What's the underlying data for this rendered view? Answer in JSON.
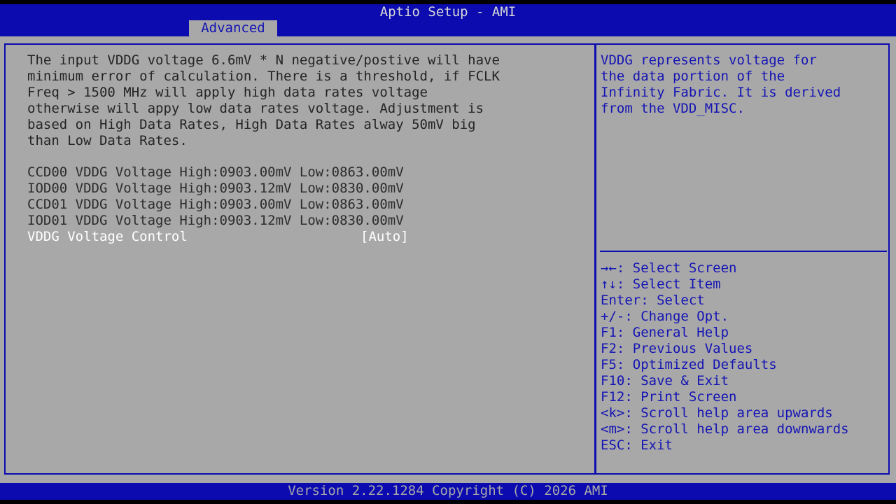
{
  "header": {
    "title": "Aptio Setup - AMI",
    "active_tab": "Advanced"
  },
  "main": {
    "description_lines": [
      "The input VDDG voltage 6.6mV * N negative/postive will have",
      "minimum error of calculation. There is a threshold, if FCLK",
      "Freq > 1500 MHz will apply high data rates voltage",
      "otherwise will appy low data rates voltage. Adjustment is",
      "based on High Data Rates, High Data Rates alway 50mV big",
      "than Low Data Rates."
    ],
    "voltage_readouts": [
      "CCD00 VDDG Voltage High:0903.00mV Low:0863.00mV",
      "IOD00 VDDG Voltage High:0903.12mV Low:0830.00mV",
      "CCD01 VDDG Voltage High:0903.00mV Low:0863.00mV",
      "IOD01 VDDG Voltage High:0903.12mV Low:0830.00mV"
    ],
    "option": {
      "label": "VDDG Voltage Control",
      "value": "[Auto]"
    }
  },
  "help_panel": {
    "lines": [
      "VDDG represents voltage for",
      "the data portion of the",
      "Infinity Fabric. It is derived",
      "from the VDD_MISC."
    ]
  },
  "key_legend": [
    "→←: Select Screen",
    "↑↓: Select Item",
    "Enter: Select",
    "+/-: Change Opt.",
    "F1: General Help",
    "F2: Previous Values",
    "F5: Optimized Defaults",
    "F10: Save & Exit",
    "F12: Print Screen",
    "<k>: Scroll help area upwards",
    "<m>: Scroll help area downwards",
    "ESC: Exit"
  ],
  "footer": {
    "version": "Version 2.22.1284 Copyright (C) 2026 AMI"
  },
  "colors": {
    "bar_blue": "#0B0BB0",
    "panel_gray": "#A8A8A8",
    "highlight_white": "#FFFFFF",
    "help_blue": "#1414B4"
  }
}
